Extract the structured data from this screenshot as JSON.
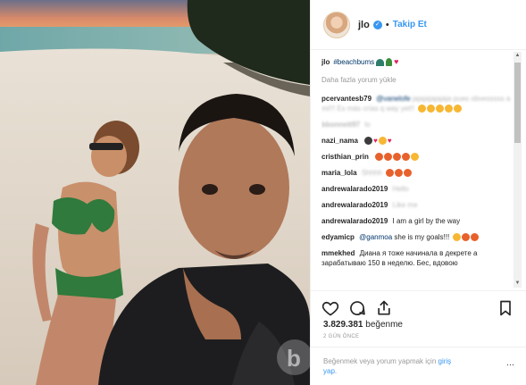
{
  "post": {
    "username": "jlo",
    "verified_mark": "✓",
    "separator": "•",
    "follow_label": "Takip Et",
    "caption_user": "jlo",
    "caption_tag": "#beachbums",
    "load_more": "Daha fazla yorum yükle",
    "likes_count": "3.829.381",
    "likes_label": "beğenme",
    "time_ago": "2 GÜN ÖNCE",
    "footer_text": "Beğenmek veya yorum yapmak için",
    "footer_login": "giriş",
    "footer_login2": "yap.",
    "more_icon": "⋯"
  },
  "comments": [
    {
      "user": "pcervantesb79",
      "mention": "@vanelofe",
      "text": "jajajajajajaja pues obvesssss a mi!!! Es más crías q way yet!!"
    },
    {
      "user": "bbonnett97",
      "text": "lo"
    },
    {
      "user": "nazi_nama",
      "text": ""
    },
    {
      "user": "cristhian_prin",
      "text": ""
    },
    {
      "user": "maria_lola",
      "text": "Shhhh"
    },
    {
      "user": "andrewalarado2019",
      "text": "Hello"
    },
    {
      "user": "andrewalarado2019",
      "text": "Like me"
    },
    {
      "user": "andrewalarado2019",
      "text": "I am a girl by the way"
    },
    {
      "user": "edyamicp",
      "mention": "@ganmoa",
      "text": "she is my goals!!!"
    },
    {
      "user": "mmekhed",
      "text": "Диана я тоже начинала в декрете а зарабатываю 150 в неделю. Бес, вдовою"
    }
  ],
  "colors": {
    "link": "#3897f0",
    "heart": "#e0245e",
    "text": "#262626",
    "muted": "#999999"
  },
  "icons": [
    "heart-icon",
    "comment-icon",
    "share-icon",
    "bookmark-icon",
    "verified-icon",
    "more-icon"
  ]
}
